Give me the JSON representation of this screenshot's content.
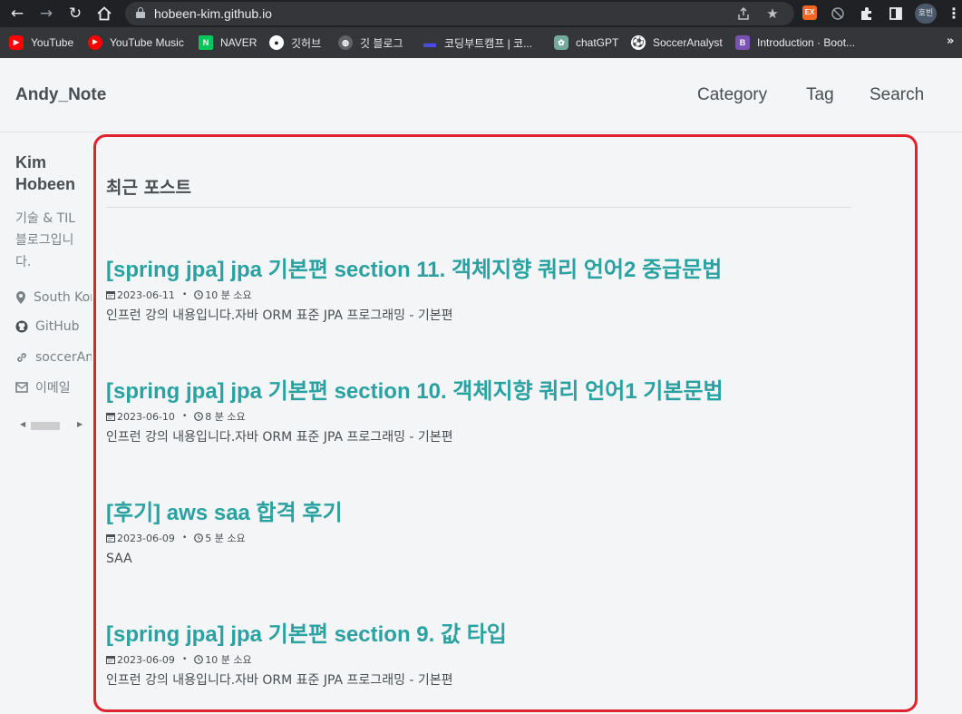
{
  "browser": {
    "url": "hobeen-kim.github.io",
    "profile_label": "호빈",
    "extension_label": "EX",
    "bookmarks": [
      {
        "label": "YouTube",
        "icon": "youtube-icon",
        "color": "#ff0000"
      },
      {
        "label": "YouTube Music",
        "icon": "youtube-music-icon",
        "color": "#ff0000"
      },
      {
        "label": "NAVER",
        "icon": "naver-icon",
        "color": "#03c75a"
      },
      {
        "label": "깃허브",
        "icon": "github-icon",
        "color": "#ffffff"
      },
      {
        "label": "깃 블로그",
        "icon": "globe-icon",
        "color": "#bdc1c6"
      },
      {
        "label": "코딩부트캠프 | 코...",
        "icon": "codestates-icon",
        "color": "#4b49e8"
      },
      {
        "label": "chatGPT",
        "icon": "chatgpt-icon",
        "color": "#74aa9c"
      },
      {
        "label": "SoccerAnalyst",
        "icon": "soccer-ball-icon",
        "color": "#ffffff"
      },
      {
        "label": "Introduction · Boot...",
        "icon": "bootstrap-icon",
        "color": "#7952b3"
      }
    ],
    "more_label": "»"
  },
  "site": {
    "title": "Andy_Note",
    "nav": [
      "Category",
      "Tag",
      "Search"
    ]
  },
  "author": {
    "name": "Kim Hobeen",
    "bio": "기술 & TIL 블로그입니다.",
    "links": [
      {
        "label": "South Korea",
        "icon": "map-marker-icon"
      },
      {
        "label": "GitHub",
        "icon": "github-icon"
      },
      {
        "label": "soccerAnalyst",
        "icon": "link-icon"
      },
      {
        "label": "이메일",
        "icon": "envelope-icon"
      }
    ]
  },
  "main": {
    "section_title": "최근 포스트",
    "accent_color": "#2aa2a2",
    "highlight_color": "#e0212e",
    "posts": [
      {
        "title": "[spring jpa] jpa 기본편 section 11. 객체지향 쿼리 언어2 중급문법",
        "date": "2023-06-11",
        "read_time": "10 분 소요",
        "excerpt": "인프런 강의 내용입니다.자바 ORM 표준 JPA 프로그래밍 - 기본편"
      },
      {
        "title": "[spring jpa] jpa 기본편 section 10. 객체지향 쿼리 언어1 기본문법",
        "date": "2023-06-10",
        "read_time": "8 분 소요",
        "excerpt": "인프런 강의 내용입니다.자바 ORM 표준 JPA 프로그래밍 - 기본편"
      },
      {
        "title": "[후기] aws saa 합격 후기",
        "date": "2023-06-09",
        "read_time": "5 분 소요",
        "excerpt": "SAA"
      },
      {
        "title": "[spring jpa] jpa 기본편 section 9. 값 타입",
        "date": "2023-06-09",
        "read_time": "10 분 소요",
        "excerpt": "인프런 강의 내용입니다.자바 ORM 표준 JPA 프로그래밍 - 기본편"
      }
    ],
    "meta_separator": "•"
  }
}
